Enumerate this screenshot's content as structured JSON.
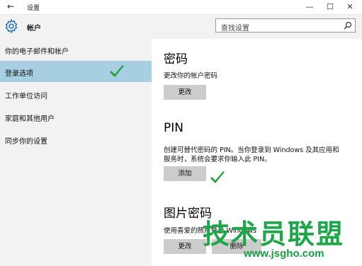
{
  "window": {
    "title": "设置",
    "back_icon": "back-arrow-icon",
    "controls": {
      "minimize": "—",
      "maximize": "☐",
      "close": "✕"
    }
  },
  "header": {
    "title": "帐户",
    "icon": "gear-icon",
    "search": {
      "placeholder": "查找设置",
      "icon": "search-icon"
    }
  },
  "sidebar": {
    "items": [
      {
        "label": "你的电子邮件和帐户",
        "selected": false
      },
      {
        "label": "登录选项",
        "selected": true
      },
      {
        "label": "工作单位访问",
        "selected": false
      },
      {
        "label": "家庭和其他用户",
        "selected": false
      },
      {
        "label": "同步你的设置",
        "selected": false
      }
    ]
  },
  "content": {
    "password": {
      "title": "密码",
      "description": "更改你的帐户密码",
      "button": "更改"
    },
    "pin": {
      "title": "PIN",
      "description_line1": "创建可替代密码的 PIN。当你登录到 Windows 及其应用和",
      "description_line2": "服务时，系统会要求你输入此 PIN。",
      "button": "添加"
    },
    "picture_password": {
      "title": "图片密码",
      "description": "使用喜爱的照片登录 Windows",
      "button_change": "更改",
      "button_remove": "删除"
    }
  },
  "annotations": {
    "check_color": "#1fa43a"
  },
  "watermark": {
    "title": "技术员联盟",
    "url": "www.jsgho.com"
  },
  "colors": {
    "selected_bg": "#a7cfe1",
    "sidebar_bg": "#f2f2f2",
    "button_bg": "#cccccc"
  }
}
